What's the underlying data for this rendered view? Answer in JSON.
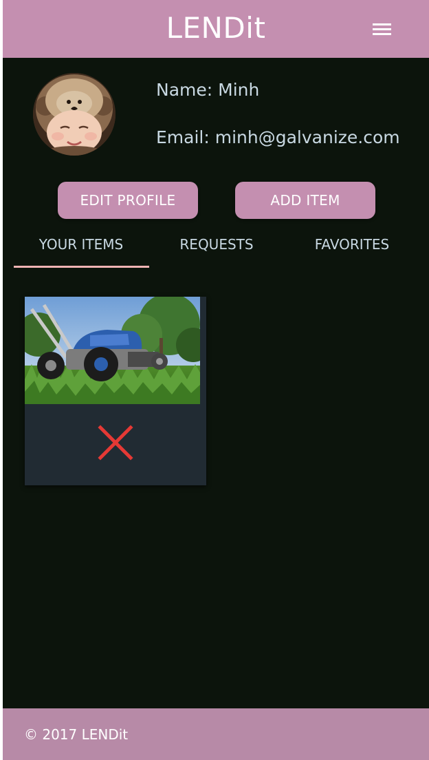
{
  "header": {
    "brand": "LENDit",
    "menu_icon": "hamburger-menu-icon"
  },
  "profile": {
    "name_text": "Name: Minh",
    "email_text": "Email: minh@galvanize.com",
    "avatar": "avatar-photo"
  },
  "actions": {
    "edit_profile": "EDIT PROFILE",
    "add_item": "ADD ITEM"
  },
  "tabs": [
    {
      "label": "YOUR ITEMS",
      "active": true
    },
    {
      "label": "REQUESTS",
      "active": false
    },
    {
      "label": "FAVORITES",
      "active": false
    }
  ],
  "items": [
    {
      "image": "lawn-mower-photo",
      "delete_icon": "close-x-icon"
    }
  ],
  "footer": {
    "copyright": "© 2017 LENDit"
  },
  "colors": {
    "header_bg": "#c48fb0",
    "footer_bg": "#b78aa7",
    "page_bg": "#0c140c",
    "text": "#c9d9e3",
    "tab_underline": "#f0b4b4",
    "card_bg": "#212b33",
    "delete_red": "#e53935"
  }
}
